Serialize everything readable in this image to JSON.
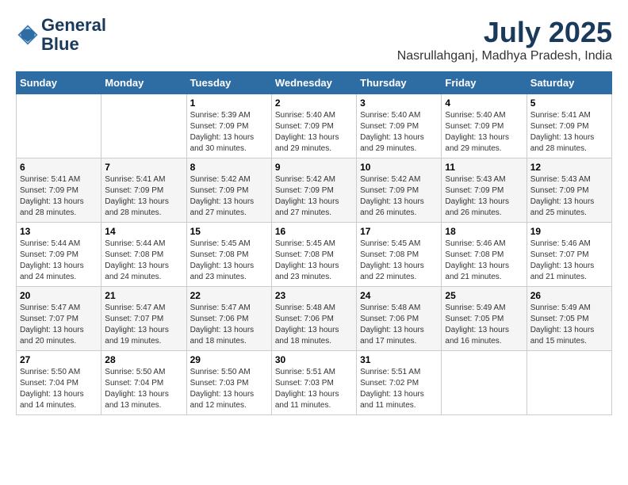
{
  "logo": {
    "line1": "General",
    "line2": "Blue"
  },
  "title": {
    "month_year": "July 2025",
    "location": "Nasrullahganj, Madhya Pradesh, India"
  },
  "headers": [
    "Sunday",
    "Monday",
    "Tuesday",
    "Wednesday",
    "Thursday",
    "Friday",
    "Saturday"
  ],
  "weeks": [
    [
      {
        "num": "",
        "detail": ""
      },
      {
        "num": "",
        "detail": ""
      },
      {
        "num": "1",
        "detail": "Sunrise: 5:39 AM\nSunset: 7:09 PM\nDaylight: 13 hours\nand 30 minutes."
      },
      {
        "num": "2",
        "detail": "Sunrise: 5:40 AM\nSunset: 7:09 PM\nDaylight: 13 hours\nand 29 minutes."
      },
      {
        "num": "3",
        "detail": "Sunrise: 5:40 AM\nSunset: 7:09 PM\nDaylight: 13 hours\nand 29 minutes."
      },
      {
        "num": "4",
        "detail": "Sunrise: 5:40 AM\nSunset: 7:09 PM\nDaylight: 13 hours\nand 29 minutes."
      },
      {
        "num": "5",
        "detail": "Sunrise: 5:41 AM\nSunset: 7:09 PM\nDaylight: 13 hours\nand 28 minutes."
      }
    ],
    [
      {
        "num": "6",
        "detail": "Sunrise: 5:41 AM\nSunset: 7:09 PM\nDaylight: 13 hours\nand 28 minutes."
      },
      {
        "num": "7",
        "detail": "Sunrise: 5:41 AM\nSunset: 7:09 PM\nDaylight: 13 hours\nand 28 minutes."
      },
      {
        "num": "8",
        "detail": "Sunrise: 5:42 AM\nSunset: 7:09 PM\nDaylight: 13 hours\nand 27 minutes."
      },
      {
        "num": "9",
        "detail": "Sunrise: 5:42 AM\nSunset: 7:09 PM\nDaylight: 13 hours\nand 27 minutes."
      },
      {
        "num": "10",
        "detail": "Sunrise: 5:42 AM\nSunset: 7:09 PM\nDaylight: 13 hours\nand 26 minutes."
      },
      {
        "num": "11",
        "detail": "Sunrise: 5:43 AM\nSunset: 7:09 PM\nDaylight: 13 hours\nand 26 minutes."
      },
      {
        "num": "12",
        "detail": "Sunrise: 5:43 AM\nSunset: 7:09 PM\nDaylight: 13 hours\nand 25 minutes."
      }
    ],
    [
      {
        "num": "13",
        "detail": "Sunrise: 5:44 AM\nSunset: 7:09 PM\nDaylight: 13 hours\nand 24 minutes."
      },
      {
        "num": "14",
        "detail": "Sunrise: 5:44 AM\nSunset: 7:08 PM\nDaylight: 13 hours\nand 24 minutes."
      },
      {
        "num": "15",
        "detail": "Sunrise: 5:45 AM\nSunset: 7:08 PM\nDaylight: 13 hours\nand 23 minutes."
      },
      {
        "num": "16",
        "detail": "Sunrise: 5:45 AM\nSunset: 7:08 PM\nDaylight: 13 hours\nand 23 minutes."
      },
      {
        "num": "17",
        "detail": "Sunrise: 5:45 AM\nSunset: 7:08 PM\nDaylight: 13 hours\nand 22 minutes."
      },
      {
        "num": "18",
        "detail": "Sunrise: 5:46 AM\nSunset: 7:08 PM\nDaylight: 13 hours\nand 21 minutes."
      },
      {
        "num": "19",
        "detail": "Sunrise: 5:46 AM\nSunset: 7:07 PM\nDaylight: 13 hours\nand 21 minutes."
      }
    ],
    [
      {
        "num": "20",
        "detail": "Sunrise: 5:47 AM\nSunset: 7:07 PM\nDaylight: 13 hours\nand 20 minutes."
      },
      {
        "num": "21",
        "detail": "Sunrise: 5:47 AM\nSunset: 7:07 PM\nDaylight: 13 hours\nand 19 minutes."
      },
      {
        "num": "22",
        "detail": "Sunrise: 5:47 AM\nSunset: 7:06 PM\nDaylight: 13 hours\nand 18 minutes."
      },
      {
        "num": "23",
        "detail": "Sunrise: 5:48 AM\nSunset: 7:06 PM\nDaylight: 13 hours\nand 18 minutes."
      },
      {
        "num": "24",
        "detail": "Sunrise: 5:48 AM\nSunset: 7:06 PM\nDaylight: 13 hours\nand 17 minutes."
      },
      {
        "num": "25",
        "detail": "Sunrise: 5:49 AM\nSunset: 7:05 PM\nDaylight: 13 hours\nand 16 minutes."
      },
      {
        "num": "26",
        "detail": "Sunrise: 5:49 AM\nSunset: 7:05 PM\nDaylight: 13 hours\nand 15 minutes."
      }
    ],
    [
      {
        "num": "27",
        "detail": "Sunrise: 5:50 AM\nSunset: 7:04 PM\nDaylight: 13 hours\nand 14 minutes."
      },
      {
        "num": "28",
        "detail": "Sunrise: 5:50 AM\nSunset: 7:04 PM\nDaylight: 13 hours\nand 13 minutes."
      },
      {
        "num": "29",
        "detail": "Sunrise: 5:50 AM\nSunset: 7:03 PM\nDaylight: 13 hours\nand 12 minutes."
      },
      {
        "num": "30",
        "detail": "Sunrise: 5:51 AM\nSunset: 7:03 PM\nDaylight: 13 hours\nand 11 minutes."
      },
      {
        "num": "31",
        "detail": "Sunrise: 5:51 AM\nSunset: 7:02 PM\nDaylight: 13 hours\nand 11 minutes."
      },
      {
        "num": "",
        "detail": ""
      },
      {
        "num": "",
        "detail": ""
      }
    ]
  ]
}
